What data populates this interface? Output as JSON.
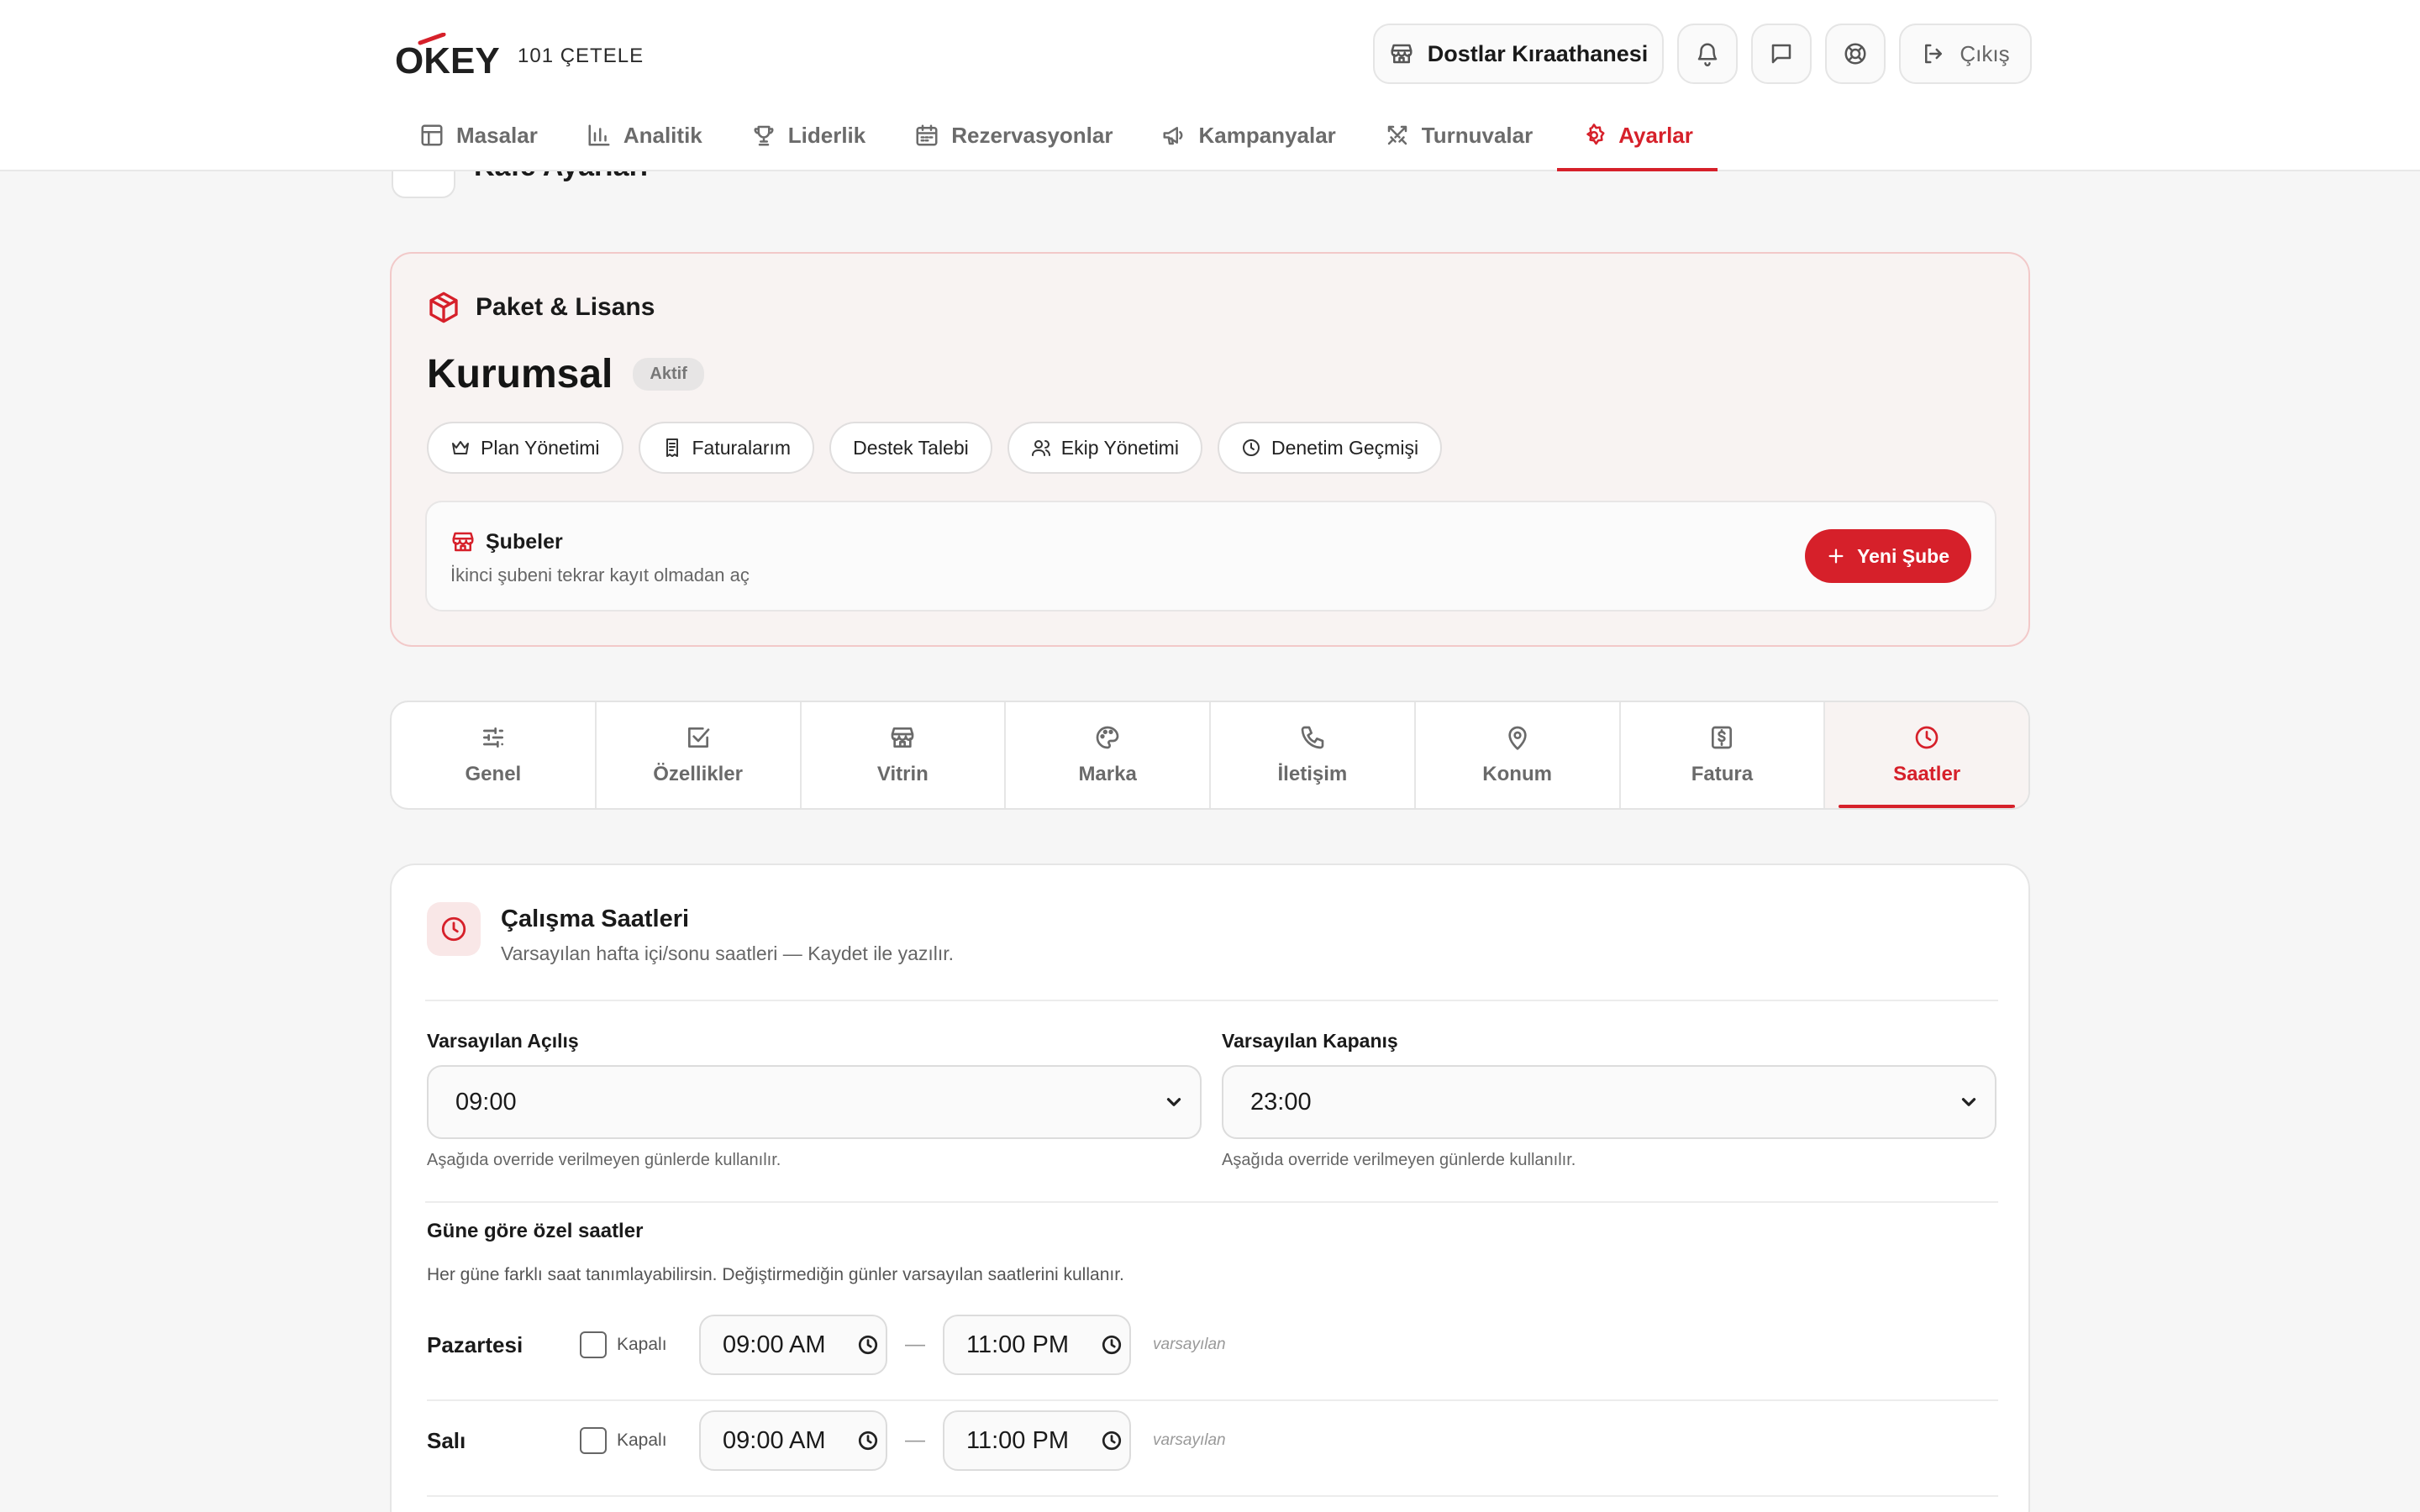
{
  "brand": {
    "logo_text": "OKEY",
    "logo_sub": "101 ÇETELE",
    "accent": "#d6202a"
  },
  "header": {
    "venue_name": "Dostlar Kıraathanesi",
    "logout_label": "Çıkış"
  },
  "nav": {
    "items": [
      {
        "label": "Masalar",
        "icon": "table-icon"
      },
      {
        "label": "Analitik",
        "icon": "bar-chart-icon"
      },
      {
        "label": "Liderlik",
        "icon": "trophy-icon"
      },
      {
        "label": "Rezervasyonlar",
        "icon": "calendar-icon"
      },
      {
        "label": "Kampanyalar",
        "icon": "megaphone-icon"
      },
      {
        "label": "Turnuvalar",
        "icon": "swords-icon"
      },
      {
        "label": "Ayarlar",
        "icon": "gear-icon",
        "active": true
      }
    ]
  },
  "page": {
    "title": "Kafe Ayarları"
  },
  "license": {
    "heading": "Paket & Lisans",
    "plan_name": "Kurumsal",
    "plan_status": "Aktif",
    "actions": [
      {
        "label": "Plan Yönetimi",
        "icon": "crown-icon"
      },
      {
        "label": "Faturalarım",
        "icon": "receipt-icon"
      },
      {
        "label": "Destek Talebi",
        "icon": ""
      },
      {
        "label": "Ekip Yönetimi",
        "icon": "users-icon"
      },
      {
        "label": "Denetim Geçmişi",
        "icon": "clock-icon"
      }
    ],
    "branches": {
      "title": "Şubeler",
      "description": "İkinci şubeni tekrar kayıt olmadan aç",
      "new_button": "Yeni Şube"
    }
  },
  "settings_tabs": [
    {
      "label": "Genel",
      "icon": "sliders-icon"
    },
    {
      "label": "Özellikler",
      "icon": "checkbox-icon"
    },
    {
      "label": "Vitrin",
      "icon": "store-icon"
    },
    {
      "label": "Marka",
      "icon": "palette-icon"
    },
    {
      "label": "İletişim",
      "icon": "phone-icon"
    },
    {
      "label": "Konum",
      "icon": "map-pin-icon"
    },
    {
      "label": "Fatura",
      "icon": "invoice-icon"
    },
    {
      "label": "Saatler",
      "icon": "clock-icon",
      "active": true
    }
  ],
  "hours": {
    "title": "Çalışma Saatleri",
    "subtitle": "Varsayılan hafta içi/sonu saatleri — Kaydet ile yazılır.",
    "default_open": {
      "label": "Varsayılan Açılış",
      "value": "09:00",
      "hint": "Aşağıda override verilmeyen günlerde kullanılır."
    },
    "default_close": {
      "label": "Varsayılan Kapanış",
      "value": "23:00",
      "hint": "Aşağıda override verilmeyen günlerde kullanılır."
    },
    "override_title": "Güne göre özel saatler",
    "override_desc": "Her güne farklı saat tanımlayabilirsin. Değiştirmediğin günler varsayılan saatlerini kullanır.",
    "days": [
      {
        "name": "Pazartesi",
        "closed_label": "Kapalı",
        "open": "09:00 AM",
        "close": "11:00 PM",
        "tag": "varsayılan"
      },
      {
        "name": "Salı",
        "closed_label": "Kapalı",
        "open": "09:00 AM",
        "close": "11:00 PM",
        "tag": "varsayılan"
      }
    ]
  }
}
